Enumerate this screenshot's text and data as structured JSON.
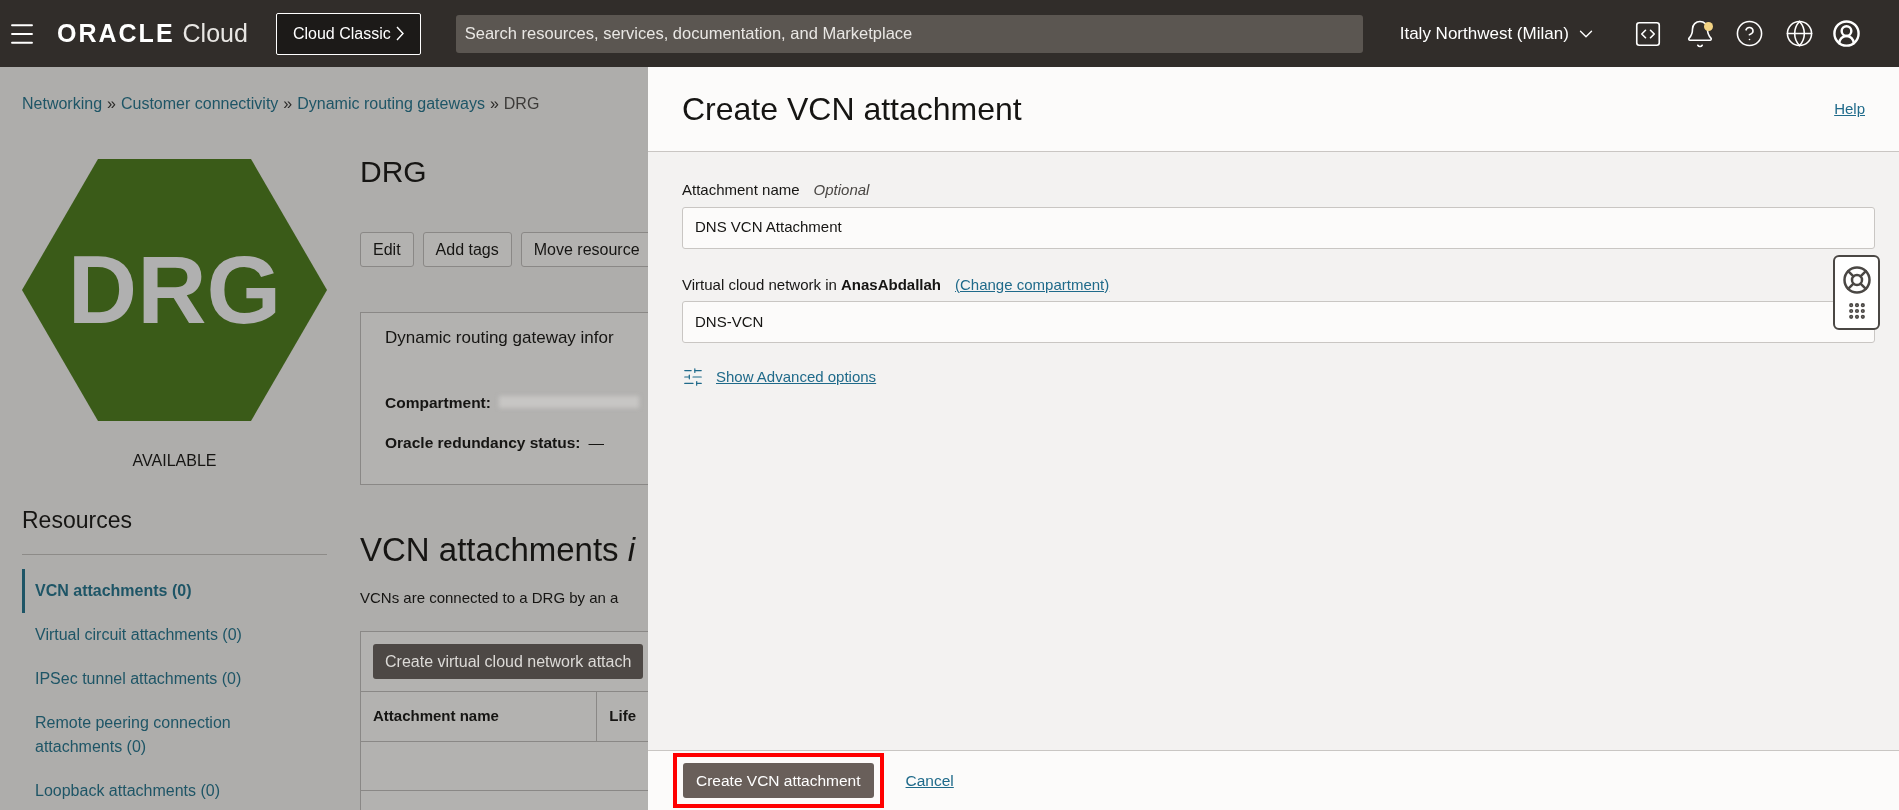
{
  "top_bar": {
    "brand": "ORACLE",
    "product": "Cloud",
    "classic_button": "Cloud Classic",
    "search": {
      "placeholder": "Search resources, services, documentation, and Marketplace"
    },
    "region": "Italy Northwest (Milan)",
    "notifications_unread": true
  },
  "page": {
    "breadcrumbs": {
      "separator": "»",
      "items": [
        {
          "label": "Networking",
          "link": true
        },
        {
          "label": "Customer connectivity",
          "link": true
        },
        {
          "label": "Dynamic routing gateways",
          "link": true
        },
        {
          "label": "DRG",
          "link": false
        }
      ]
    },
    "resource": {
      "icon_text": "DRG",
      "status": "AVAILABLE"
    },
    "title": "DRG",
    "actions": [
      "Edit",
      "Add tags",
      "Move resource"
    ],
    "info": {
      "heading": "Dynamic routing gateway infor",
      "fields": [
        {
          "label": "Compartment:",
          "redacted": true
        },
        {
          "label": "Oracle redundancy status:",
          "value": "—",
          "redacted": false
        }
      ]
    },
    "resources": {
      "heading": "Resources",
      "items": [
        {
          "label": "VCN attachments (0)",
          "selected": true
        },
        {
          "label": "Virtual circuit attachments (0)",
          "selected": false
        },
        {
          "label": "IPSec tunnel attachments (0)",
          "selected": false
        },
        {
          "label": "Remote peering connection attachments (0)",
          "selected": false
        },
        {
          "label": "Loopback attachments (0)",
          "selected": false
        }
      ]
    },
    "section": {
      "title": "VCN attachments *i*",
      "description": "VCNs are connected to a DRG by an a",
      "create_button": "Create virtual cloud network attach",
      "columns": [
        "Attachment name",
        "Life"
      ]
    }
  },
  "panel": {
    "title": "Create VCN attachment",
    "help": "Help",
    "fields": [
      {
        "label": "Attachment name",
        "hint": "Optional",
        "value": "DNS VCN Attachment"
      },
      {
        "label": "Virtual cloud network in **AnasAbdallah**",
        "link": "(Change compartment)",
        "value": "DNS-VCN"
      }
    ],
    "advanced": "Show Advanced options",
    "footer": {
      "primary": "Create VCN attachment",
      "highlighted": true,
      "cancel": "Cancel"
    }
  }
}
